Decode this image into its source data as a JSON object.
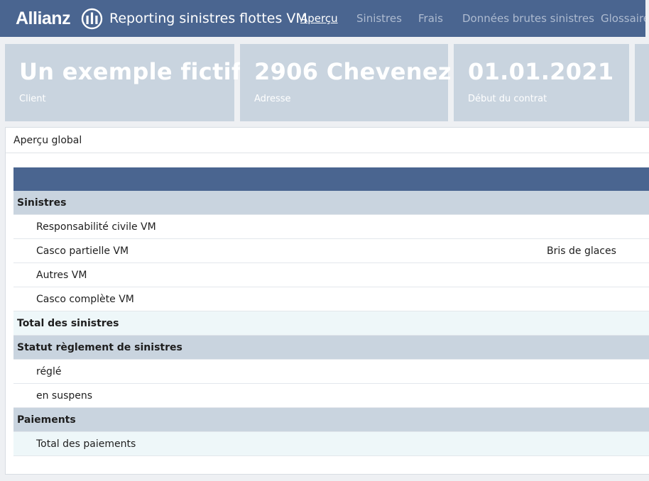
{
  "header": {
    "brand": "Allianz",
    "title": "Reporting sinistres flottes VM",
    "nav": [
      {
        "label": "Aperçu",
        "active": true
      },
      {
        "label": "Sinistres",
        "active": false
      },
      {
        "label": "Frais",
        "active": false
      },
      {
        "label": "Données brutes sinistres",
        "active": false
      },
      {
        "label": "Glossaire",
        "active": false
      }
    ]
  },
  "cards": [
    {
      "value": "Un exemple fictif",
      "label": "Client"
    },
    {
      "value": "2906 Chevenez",
      "label": "Adresse"
    },
    {
      "value": "01.01.2021",
      "label": "Début du contrat"
    }
  ],
  "panel": {
    "title": "Aperçu global",
    "rows": [
      {
        "label": "Sinistres",
        "type": "section"
      },
      {
        "label": "Responsabilité civile VM",
        "type": "plain"
      },
      {
        "label": "Casco partielle VM",
        "type": "plain",
        "right": "Bris de glaces"
      },
      {
        "label": "Autres VM",
        "type": "plain"
      },
      {
        "label": "Casco complète VM",
        "type": "plain"
      },
      {
        "label": "Total des sinistres",
        "type": "total"
      },
      {
        "label": "Statut règlement de sinistres",
        "type": "section"
      },
      {
        "label": "réglé",
        "type": "plain"
      },
      {
        "label": "en suspens",
        "type": "plain"
      },
      {
        "label": "Paiements",
        "type": "section"
      },
      {
        "label": "Total des paiements",
        "type": "total-sub"
      }
    ]
  },
  "colors": {
    "navbar": "#4a6590",
    "card": "#c9d4df",
    "section_row": "#c9d4df",
    "total_row": "#eef7f9"
  },
  "icons": {
    "brand_logo": "allianz-eagle-icon"
  }
}
